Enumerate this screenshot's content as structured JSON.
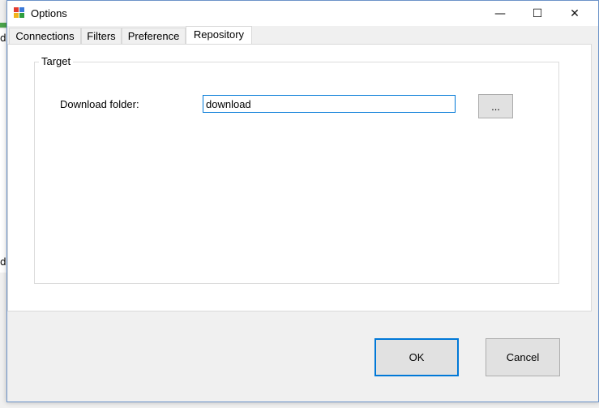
{
  "background_app": {
    "left_text_top": "ds",
    "left_text_bottom": "dy"
  },
  "window": {
    "title": "Options",
    "minimize_glyph": "—",
    "maximize_glyph": "☐",
    "close_glyph": "✕"
  },
  "tabs": [
    {
      "label": "Connections",
      "active": false
    },
    {
      "label": "Filters",
      "active": false
    },
    {
      "label": "Preference",
      "active": false
    },
    {
      "label": "Repository",
      "active": true
    }
  ],
  "target_group": {
    "legend": "Target",
    "download_folder_label": "Download folder:",
    "download_folder_value": "download",
    "browse_label": "..."
  },
  "footer": {
    "ok_label": "OK",
    "cancel_label": "Cancel"
  },
  "colors": {
    "focus_accent": "#0078d7",
    "window_border": "#6d94c9"
  }
}
